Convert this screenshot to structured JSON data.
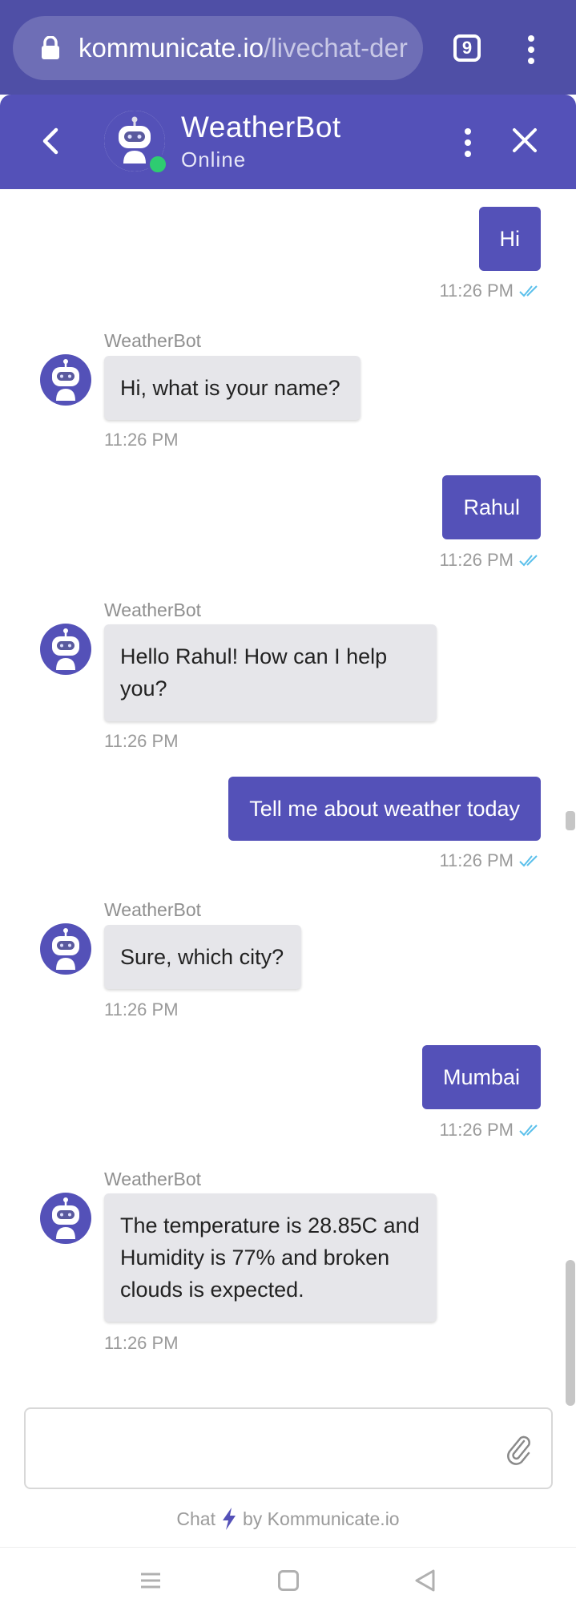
{
  "browser": {
    "url_host": "kommunicate.io",
    "url_path": "/livechat-der",
    "tab_count": "9"
  },
  "chat_header": {
    "title": "WeatherBot",
    "status": "Online"
  },
  "messages": [
    {
      "from": "user",
      "text": "Hi",
      "time": "11:26 PM"
    },
    {
      "from": "bot",
      "sender": "WeatherBot",
      "text": "Hi, what is your name?",
      "time": "11:26 PM"
    },
    {
      "from": "user",
      "text": "Rahul",
      "time": "11:26 PM"
    },
    {
      "from": "bot",
      "sender": "WeatherBot",
      "text": "Hello Rahul! How can I help you?",
      "time": "11:26 PM"
    },
    {
      "from": "user",
      "text": "Tell me about weather today",
      "time": "11:26 PM"
    },
    {
      "from": "bot",
      "sender": "WeatherBot",
      "text": "Sure, which city?",
      "time": "11:26 PM"
    },
    {
      "from": "user",
      "text": "Mumbai",
      "time": "11:26 PM"
    },
    {
      "from": "bot",
      "sender": "WeatherBot",
      "text": "The temperature is 28.85C and Humidity is 77% and broken clouds is expected.",
      "time": "11:26 PM"
    }
  ],
  "composer": {
    "placeholder": ""
  },
  "footer": {
    "prefix": "Chat",
    "suffix": "by Kommunicate.io"
  },
  "colors": {
    "primary": "#5451b8",
    "browser_bar": "#4f4fa6",
    "bot_bubble": "#e6e6ea",
    "read_ticks": "#5bc0eb",
    "online": "#2ecc71"
  }
}
